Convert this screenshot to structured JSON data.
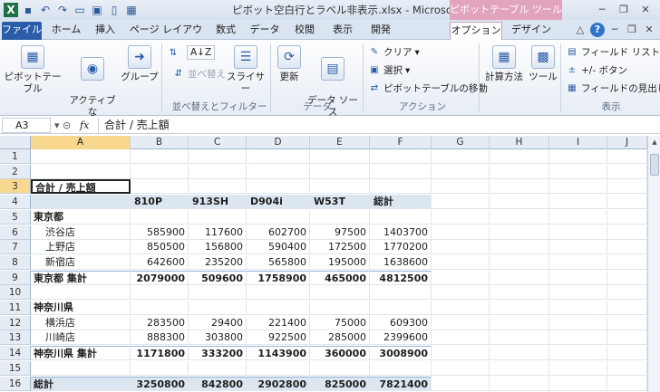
{
  "title_bar": {
    "title": "ピボット空白行とラベル非表示.xlsx - Microsoft Excel",
    "context_title": "ピボットテーブル ツール",
    "qat_icons": [
      "excel-icon",
      "save-icon",
      "undo-icon",
      "redo-icon",
      "open-icon",
      "print-preview-icon",
      "new-icon",
      "pivot-icon"
    ]
  },
  "tabs": [
    "ファイル",
    "ホーム",
    "挿入",
    "ページ レイアウト",
    "数式",
    "データ",
    "校閲",
    "表示",
    "開発",
    "オプション",
    "デザイン"
  ],
  "active_tab": "オプション",
  "ribbon": {
    "pivot_table": "ピボットテーブル",
    "active_field": "アクティブな\nフィールド",
    "group": "グループ",
    "sort_az": "A↓Z",
    "sort": "並べ替え",
    "slicer": "スライサー",
    "refresh": "更新",
    "data_source": "データ ソース\nの変更",
    "clear": "クリア",
    "select": "選択",
    "move_pivot": "ピボットテーブルの移動",
    "calc": "計算方法",
    "tools": "ツール",
    "field_list": "フィールド リスト",
    "plus_minus": "+/- ボタン",
    "field_headers": "フィールドの見出し",
    "groups": {
      "sort_filter": "並べ替えとフィルター",
      "data": "データ",
      "action": "アクション",
      "display": "表示"
    }
  },
  "formula_bar": {
    "name_box": "A3",
    "fx": "fx",
    "value": "合計 / 売上額"
  },
  "columns": [
    "A",
    "B",
    "C",
    "D",
    "E",
    "F",
    "G",
    "H",
    "I",
    "J"
  ],
  "rows": [
    {
      "n": "1",
      "cells": [
        "",
        "",
        "",
        "",
        "",
        ""
      ]
    },
    {
      "n": "2",
      "cells": [
        "",
        "",
        "",
        "",
        "",
        ""
      ]
    },
    {
      "n": "3",
      "cells": [
        "合計 / 売上額",
        "",
        "",
        "",
        "",
        ""
      ]
    },
    {
      "n": "4",
      "cells": [
        "",
        "810P",
        "913SH",
        "D904i",
        "W53T",
        "総計"
      ]
    },
    {
      "n": "5",
      "cells": [
        "東京都",
        "",
        "",
        "",
        "",
        ""
      ]
    },
    {
      "n": "6",
      "cells": [
        "渋谷店",
        "585900",
        "117600",
        "602700",
        "97500",
        "1403700"
      ]
    },
    {
      "n": "7",
      "cells": [
        "上野店",
        "850500",
        "156800",
        "590400",
        "172500",
        "1770200"
      ]
    },
    {
      "n": "8",
      "cells": [
        "新宿店",
        "642600",
        "235200",
        "565800",
        "195000",
        "1638600"
      ]
    },
    {
      "n": "9",
      "cells": [
        "東京都 集計",
        "2079000",
        "509600",
        "1758900",
        "465000",
        "4812500"
      ]
    },
    {
      "n": "10",
      "cells": [
        "",
        "",
        "",
        "",
        "",
        ""
      ]
    },
    {
      "n": "11",
      "cells": [
        "神奈川県",
        "",
        "",
        "",
        "",
        ""
      ]
    },
    {
      "n": "12",
      "cells": [
        "横浜店",
        "283500",
        "29400",
        "221400",
        "75000",
        "609300"
      ]
    },
    {
      "n": "13",
      "cells": [
        "川崎店",
        "888300",
        "303800",
        "922500",
        "285000",
        "2399600"
      ]
    },
    {
      "n": "14",
      "cells": [
        "神奈川県 集計",
        "1171800",
        "333200",
        "1143900",
        "360000",
        "3008900"
      ]
    },
    {
      "n": "15",
      "cells": [
        "",
        "",
        "",
        "",
        "",
        ""
      ]
    },
    {
      "n": "16",
      "cells": [
        "総計",
        "3250800",
        "842800",
        "2902800",
        "825000",
        "7821400"
      ]
    }
  ],
  "colors": {
    "accent": "#2a5ca8",
    "context_tab": "#e2a3bd",
    "band": "#dce6f1",
    "selected_header": "#f8d88f"
  }
}
